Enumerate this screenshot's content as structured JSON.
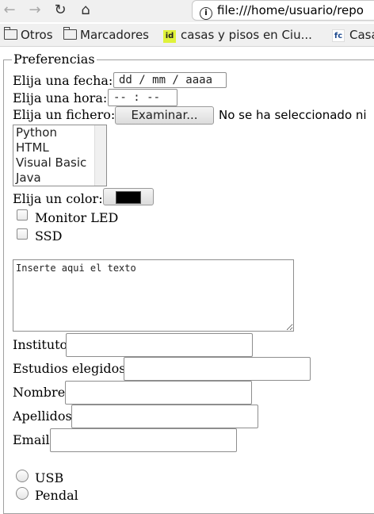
{
  "browser": {
    "url": "file:///home/usuario/repo",
    "bookmarks": [
      "Otros",
      "Marcadores",
      "casas y pisos en Ciu...",
      "Casa"
    ],
    "bookmark_icons": [
      "folder-icon",
      "folder-icon",
      "id",
      "fc"
    ]
  },
  "form": {
    "legend": "Preferencias",
    "date_label": "Elija una fecha:",
    "date_placeholder": "dd / mm / aaaa",
    "time_label": "Elija una hora:",
    "time_placeholder": "-- : --",
    "file_label": "Elija un fichero:",
    "file_button": "Examinar...",
    "file_status": "No se ha seleccionado ni",
    "languages": [
      "Python",
      "HTML",
      "Visual Basic",
      "Java"
    ],
    "color_label": "Elija un color:",
    "color_value": "#000000",
    "checkboxes": [
      "Monitor LED",
      "SSD"
    ],
    "textarea_text": "Inserte aqui el texto",
    "fields": {
      "instituto": "Instituto",
      "estudios": "Estudios elegidos",
      "nombre": "Nombre",
      "apellidos": "Apellidos",
      "email": "Email"
    },
    "radios": [
      "USB",
      "Pendal"
    ]
  }
}
